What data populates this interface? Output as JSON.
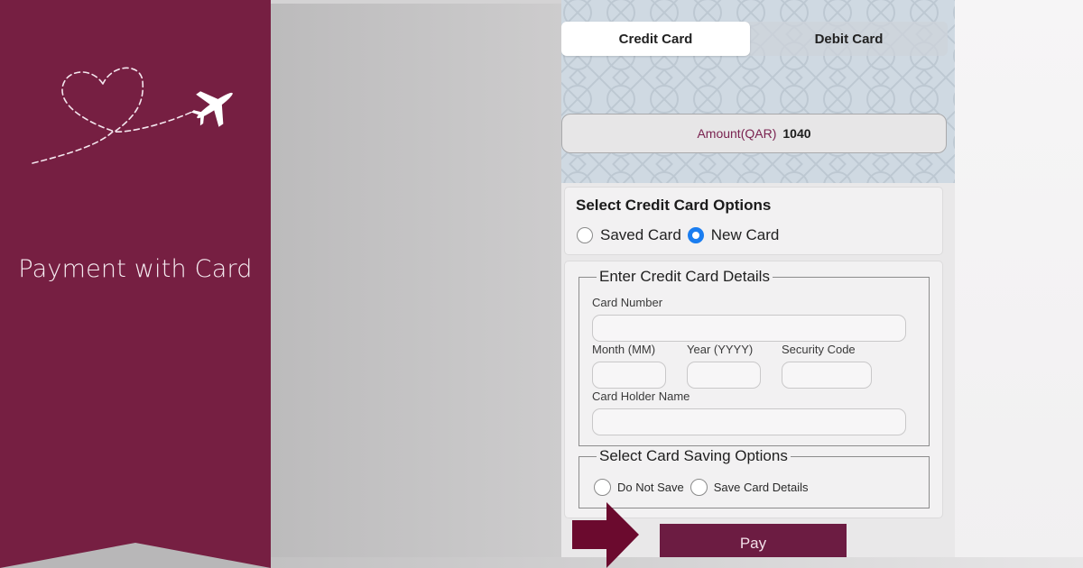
{
  "banner": {
    "title": "Payment with Card",
    "background_color": "#761f42",
    "decor_icons": [
      "dashed-heart-icon",
      "airplane-icon"
    ]
  },
  "payment_screen": {
    "tabs": [
      {
        "label": "Credit Card",
        "selected": true
      },
      {
        "label": "Debit Card",
        "selected": false
      }
    ],
    "amount": {
      "label": "Amount(QAR)",
      "value": "1040"
    },
    "card_options": {
      "title": "Select Credit Card Options",
      "options": [
        {
          "label": "Saved Card",
          "selected": false
        },
        {
          "label": "New Card",
          "selected": true
        }
      ]
    },
    "card_details": {
      "legend": "Enter Credit Card Details",
      "fields": {
        "card_number": {
          "label": "Card Number",
          "value": ""
        },
        "month": {
          "label": "Month (MM)",
          "value": ""
        },
        "year": {
          "label": "Year (YYYY)",
          "value": ""
        },
        "security_code": {
          "label": "Security Code",
          "value": ""
        },
        "holder_name": {
          "label": "Card Holder Name",
          "value": ""
        }
      }
    },
    "saving_options": {
      "legend": "Select Card Saving Options",
      "options": [
        {
          "label": "Do Not Save",
          "selected": false
        },
        {
          "label": "Save Card Details",
          "selected": false
        }
      ]
    },
    "pay_button": {
      "label": "Pay",
      "color": "#6c1c42"
    },
    "highlight_arrow": {
      "color": "#6b0a2e",
      "points_to": "pay-button"
    },
    "radio_selected_color": "#1a7df0"
  }
}
